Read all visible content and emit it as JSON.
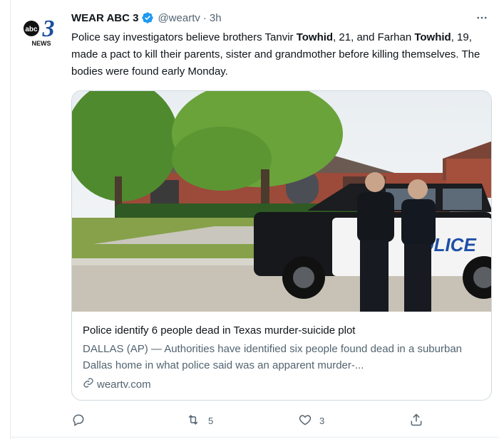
{
  "tweet": {
    "author": {
      "name": "WEAR ABC 3",
      "handle": "@weartv",
      "separator": "·",
      "time": "3h",
      "avatar_logo": "abc 3 NEWS"
    },
    "text": {
      "p1": "Police say investigators believe brothers Tanvir ",
      "b1": "Towhid",
      "p2": ", 21, and Farhan ",
      "b2": "Towhid",
      "p3": ", 19, made a pact to kill their parents, sister and grandmother before killing themselves. The bodies were found early Monday."
    },
    "card": {
      "image_alt": "Police officers standing beside a police SUV outside a brick house",
      "vehicle_text": "POLICE",
      "title": "Police identify 6 people dead in Texas murder-suicide plot",
      "description": "DALLAS (AP) — Authorities have identified six people found dead in a suburban Dallas home in what police said was an apparent murder-...",
      "domain": "weartv.com"
    },
    "actions": {
      "reply_count": "",
      "retweet_count": "5",
      "like_count": "3"
    },
    "icons": [
      "verified-badge-icon",
      "more-icon",
      "link-icon",
      "reply-icon",
      "retweet-icon",
      "like-icon",
      "share-icon"
    ],
    "colors": {
      "brand_blue": "#1d9bf0",
      "text": "#0f1419",
      "muted": "#536471",
      "border": "#cfd9de"
    }
  }
}
